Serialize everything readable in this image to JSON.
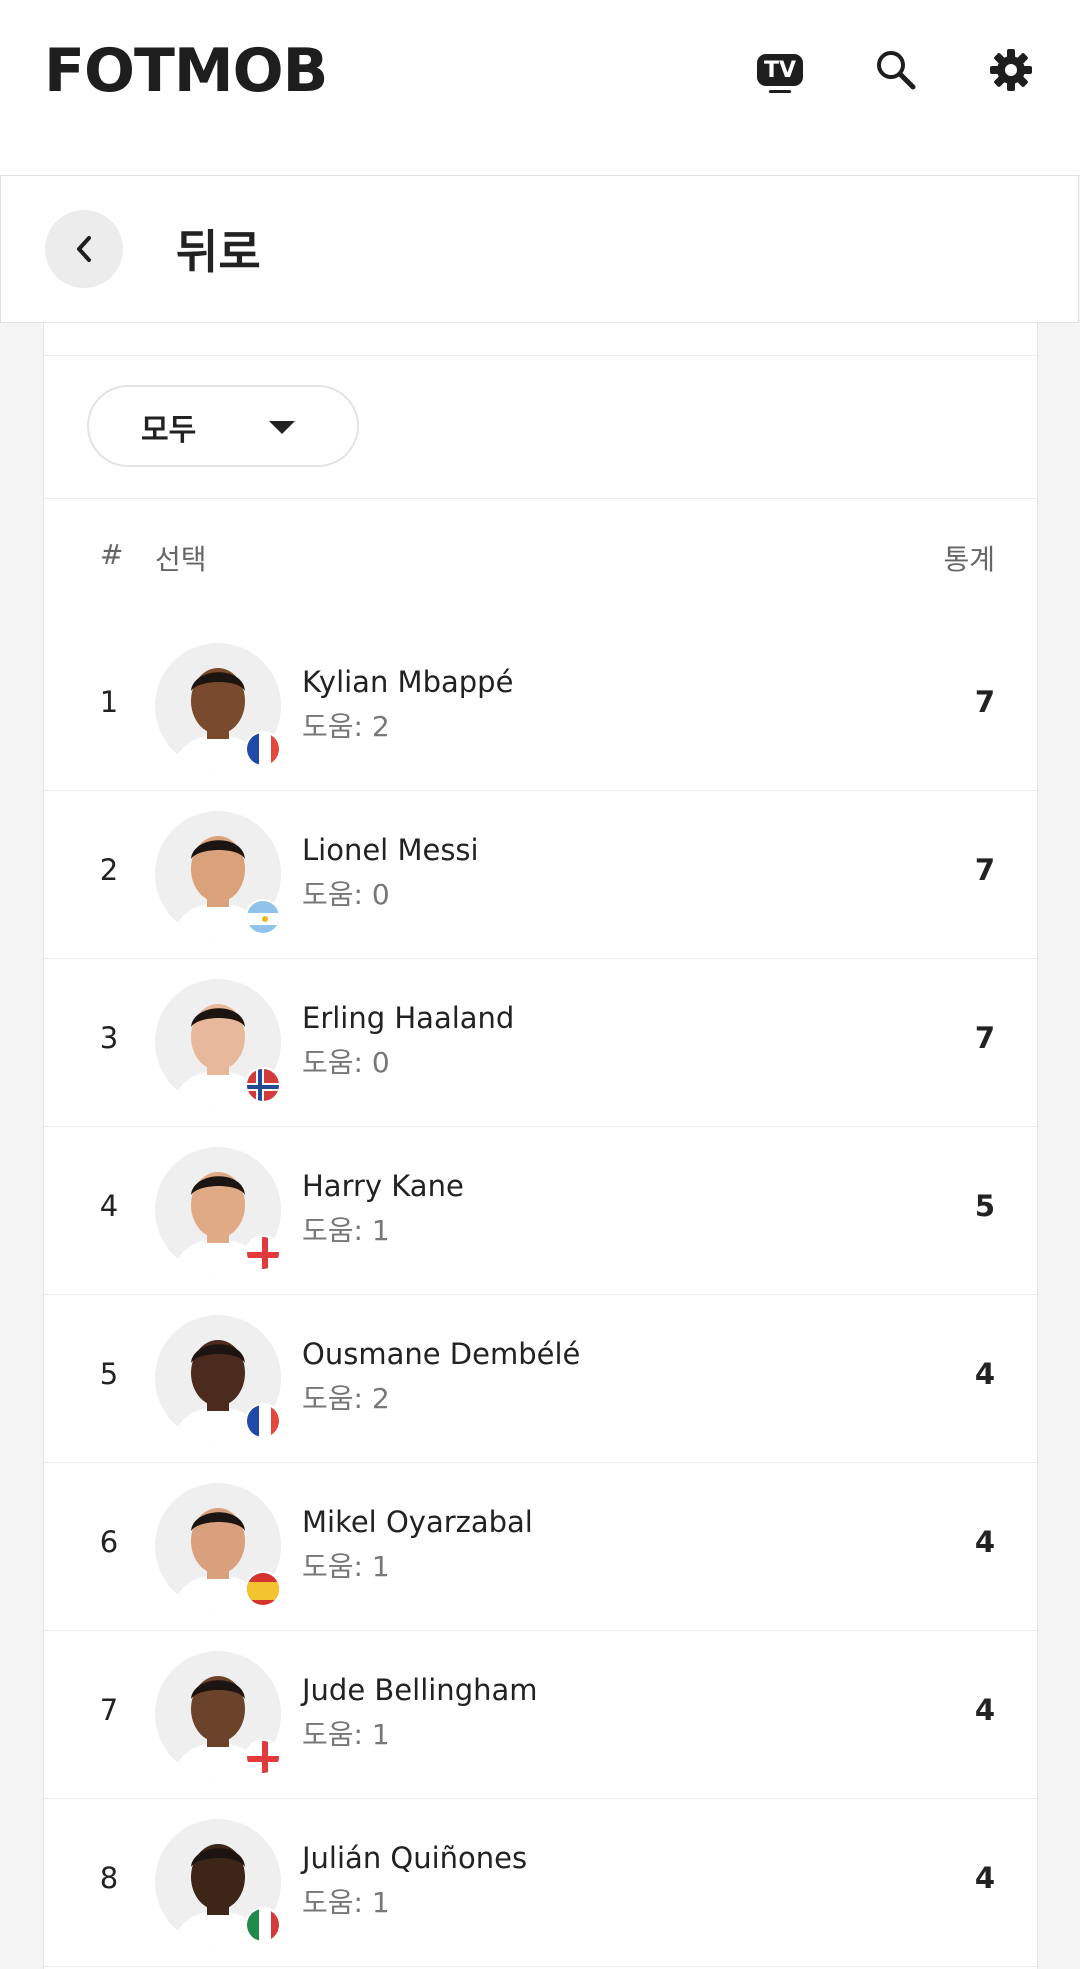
{
  "header": {
    "logo_text": "FOTMOB",
    "tv_label": "TV",
    "icons": [
      "tv-icon",
      "search-icon",
      "gear-icon"
    ]
  },
  "back": {
    "title": "뒤로"
  },
  "filter": {
    "selected": "모두"
  },
  "table": {
    "columns": {
      "rank": "#",
      "player": "선택",
      "stat": "통계"
    },
    "rows": [
      {
        "rank": "1",
        "name": "Kylian Mbappé",
        "sub": "도움: 2",
        "stat": "7",
        "flag": "france",
        "skin": "#7a4a2c"
      },
      {
        "rank": "2",
        "name": "Lionel Messi",
        "sub": "도움: 0",
        "stat": "7",
        "flag": "argentina",
        "skin": "#d9a27a"
      },
      {
        "rank": "3",
        "name": "Erling Haaland",
        "sub": "도움: 0",
        "stat": "7",
        "flag": "norway",
        "skin": "#e7b99a"
      },
      {
        "rank": "4",
        "name": "Harry Kane",
        "sub": "도움: 1",
        "stat": "5",
        "flag": "england",
        "skin": "#e0aa86"
      },
      {
        "rank": "5",
        "name": "Ousmane Dembélé",
        "sub": "도움: 2",
        "stat": "4",
        "flag": "france",
        "skin": "#4a2b1d"
      },
      {
        "rank": "6",
        "name": "Mikel Oyarzabal",
        "sub": "도움: 1",
        "stat": "4",
        "flag": "spain",
        "skin": "#d8a07c"
      },
      {
        "rank": "7",
        "name": "Jude Bellingham",
        "sub": "도움: 1",
        "stat": "4",
        "flag": "england",
        "skin": "#6b432b"
      },
      {
        "rank": "8",
        "name": "Julián Quiñones",
        "sub": "도움: 1",
        "stat": "4",
        "flag": "mexico",
        "skin": "#3d2618"
      }
    ]
  },
  "colors": {
    "background": "#f5f5f5",
    "card": "#ffffff",
    "text": "#222222",
    "muted": "#777777"
  }
}
